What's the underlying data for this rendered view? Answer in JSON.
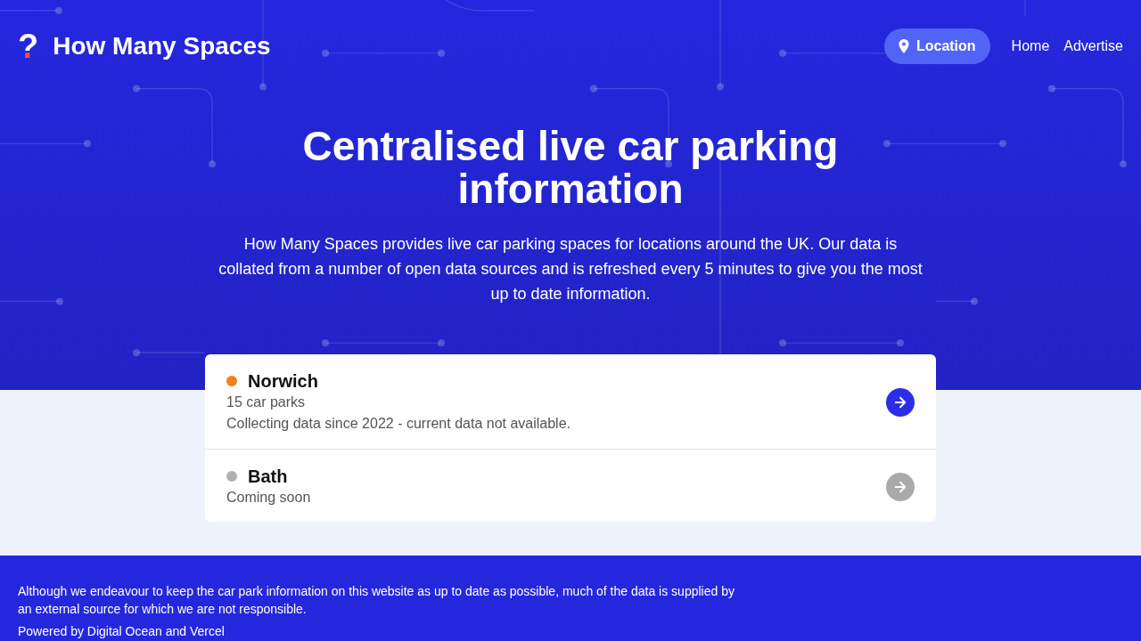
{
  "header": {
    "logo": {
      "mark": "?",
      "name": "How Many Spaces"
    },
    "location_button": "Location",
    "nav_links": [
      "Home",
      "Advertise"
    ]
  },
  "hero": {
    "title": "Centralised live car parking information",
    "description": "How Many Spaces provides live car parking spaces for locations around the UK. Our data is collated from a number of open data sources and is refreshed every 5 minutes to give you the most up to date information."
  },
  "locations": [
    {
      "name": "Norwich",
      "color": "#f0821a",
      "details": [
        "15 car parks",
        "Collecting data since 2022 - current data not available."
      ],
      "disabled": false
    },
    {
      "name": "Bath",
      "color": "#b0b0b0",
      "details": [
        "Coming soon"
      ],
      "disabled": true
    }
  ],
  "footer": {
    "disclaimer": "Although we endeavour to keep the car park information on this website as up to date as possible, much of the data is supplied by an external source for which we are not responsible.",
    "credits": "Powered by Digital Ocean and Vercel"
  }
}
